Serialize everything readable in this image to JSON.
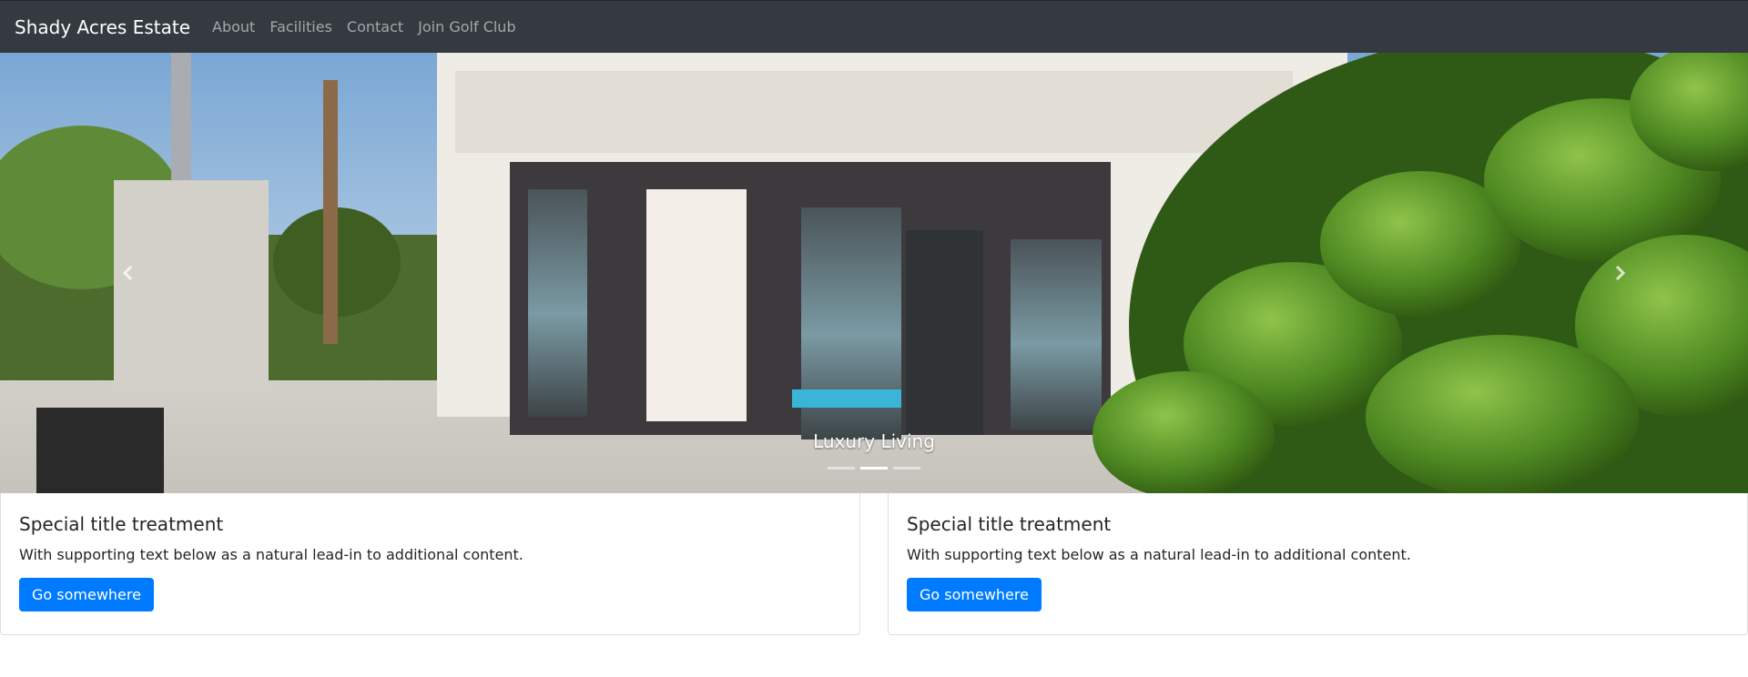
{
  "navbar": {
    "brand": "Shady Acres Estate",
    "links": [
      "About",
      "Facilities",
      "Contact",
      "Join Golf Club"
    ]
  },
  "carousel": {
    "caption": "Luxury Living",
    "indicator_count": 3,
    "active_indicator": 2,
    "prev_icon": "chevron-left-icon",
    "next_icon": "chevron-right-icon"
  },
  "cards": [
    {
      "title": "Special title treatment",
      "text": "With supporting text below as a natural lead-in to additional content.",
      "button": "Go somewhere"
    },
    {
      "title": "Special title treatment",
      "text": "With supporting text below as a natural lead-in to additional content.",
      "button": "Go somewhere"
    }
  ],
  "colors": {
    "navbar": "#343a40",
    "primary": "#007bff"
  }
}
